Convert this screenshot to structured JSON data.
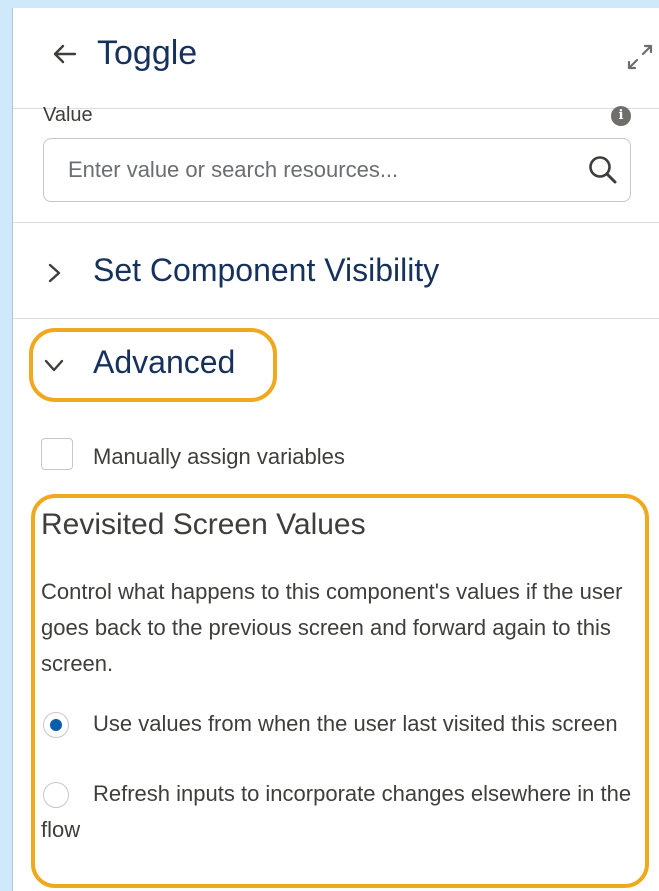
{
  "header": {
    "back_icon": "arrow-left-icon",
    "title": "Toggle",
    "expand_icon": "expand-icon"
  },
  "value_field": {
    "label": "Value",
    "info_icon": "info-icon",
    "placeholder": "Enter value or search resources...",
    "search_icon": "search-icon"
  },
  "sections": {
    "visibility": {
      "label": "Set Component Visibility",
      "expanded": false,
      "icon": "chevron-right-icon"
    },
    "advanced": {
      "label": "Advanced",
      "expanded": true,
      "icon": "chevron-down-icon"
    }
  },
  "manual_assign": {
    "label": "Manually assign variables",
    "checked": false
  },
  "revisited": {
    "title": "Revisited Screen Values",
    "description": "Control what happens to this component's values if the user goes back to the previous screen and forward again to this screen.",
    "options": [
      {
        "label": "Use values from when the user last visited this screen",
        "selected": true
      },
      {
        "label": "Refresh inputs to incorporate changes elsewhere in the flow",
        "selected": false
      }
    ]
  },
  "colors": {
    "highlight": "#f0a81e",
    "radio_selected": "#0b5cab",
    "title_text": "#16325c",
    "background": "#cfe9fb"
  }
}
